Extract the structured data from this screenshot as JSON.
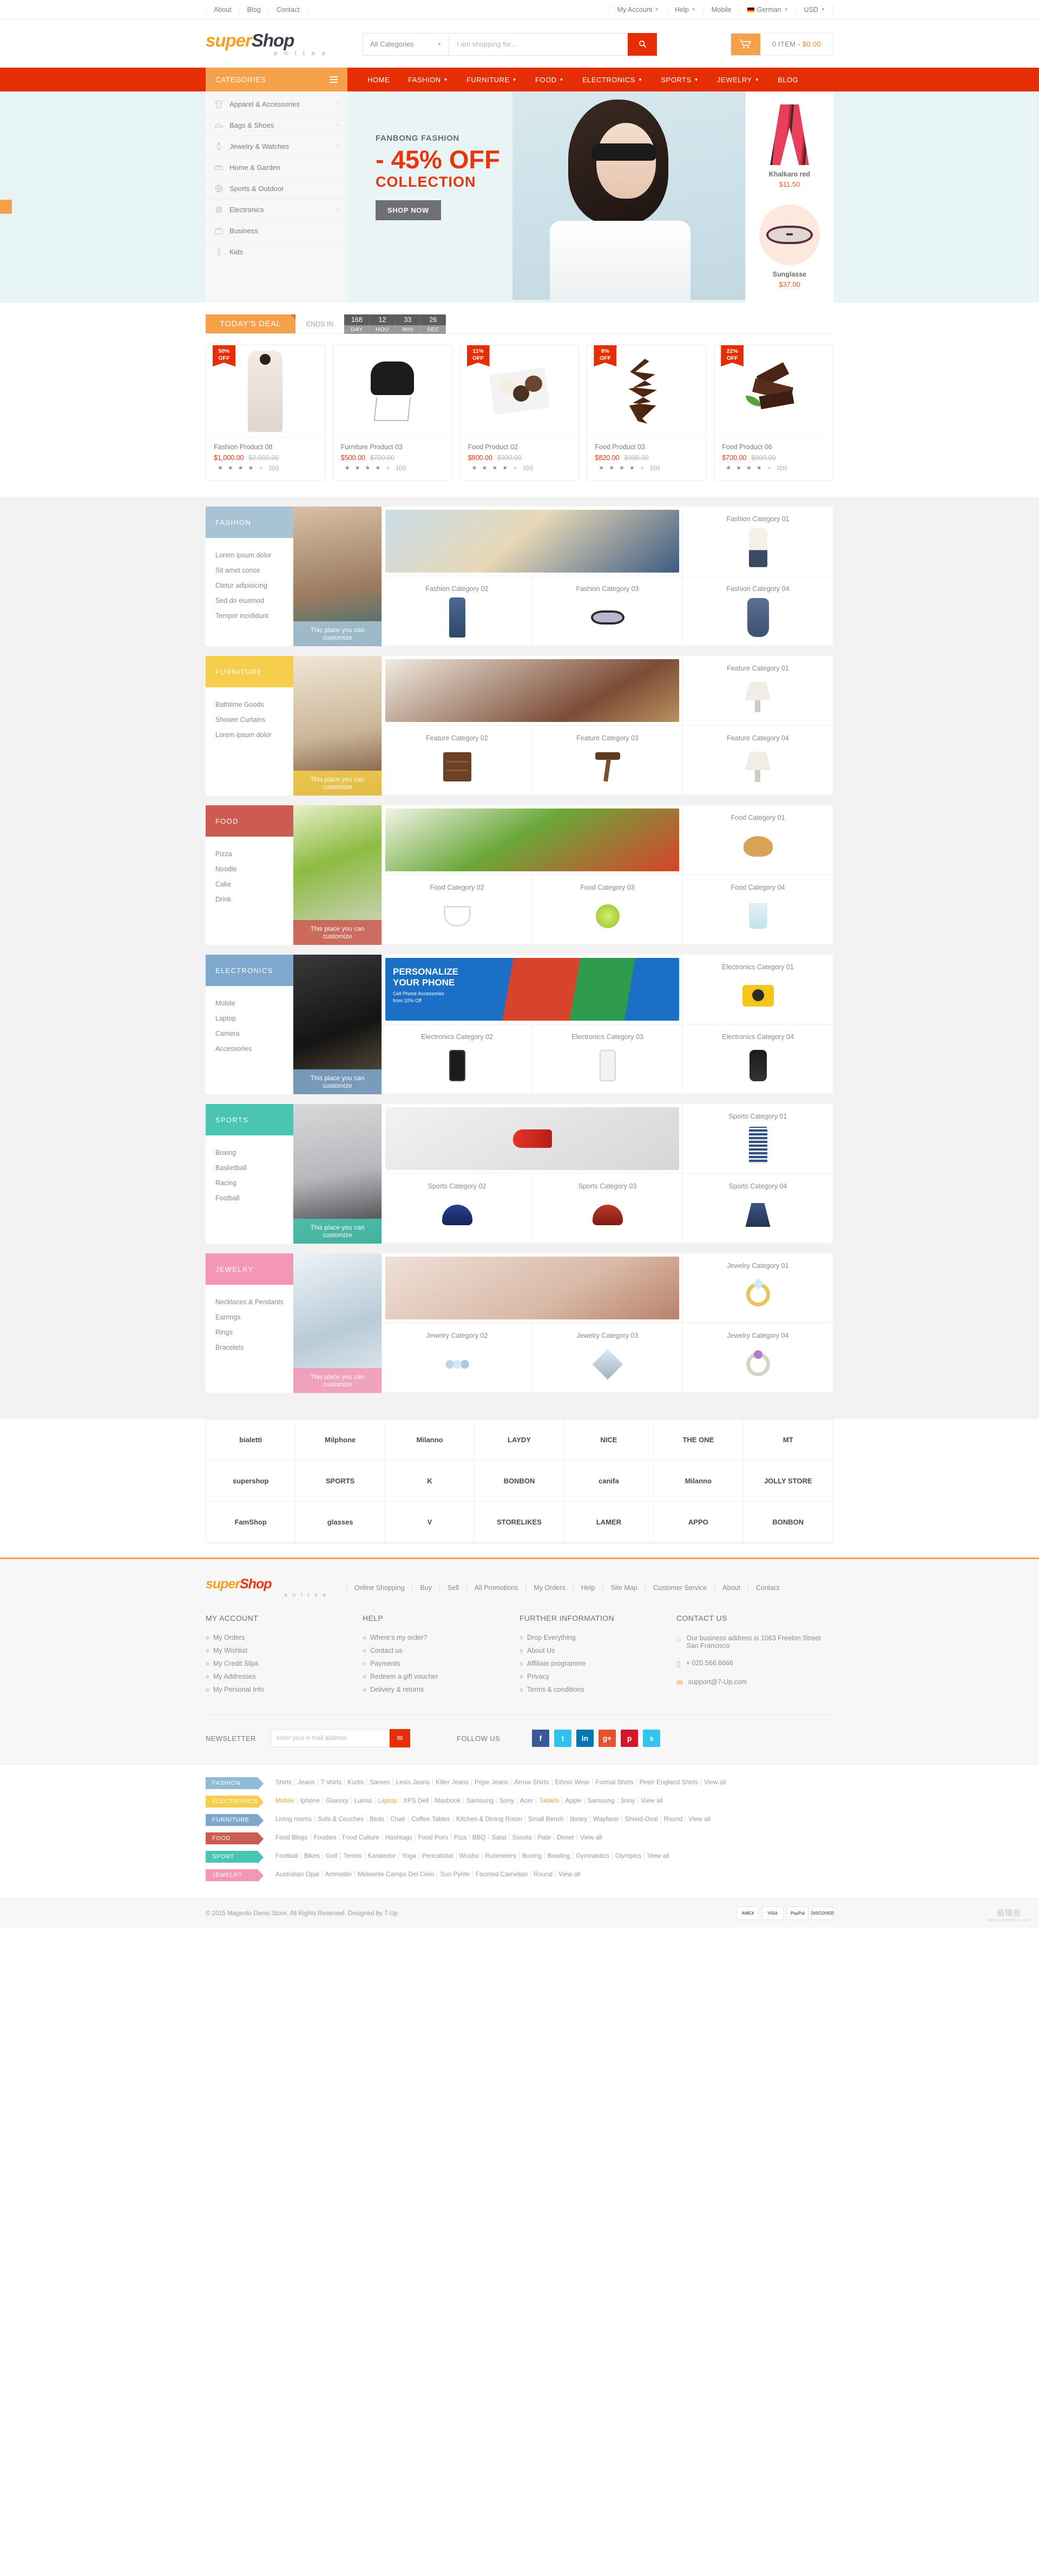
{
  "topbar": {
    "left": [
      {
        "label": "About"
      },
      {
        "label": "Blog"
      },
      {
        "label": "Contact"
      }
    ],
    "right": [
      {
        "label": "My Account",
        "caret": true
      },
      {
        "label": "Help",
        "caret": true
      },
      {
        "label": "Mobile",
        "caret": false
      },
      {
        "label": "German",
        "caret": true,
        "flag": "de-flag-icon"
      },
      {
        "label": "USD",
        "caret": true
      }
    ]
  },
  "header": {
    "logo": {
      "super": "super",
      "shop": "Shop",
      "sub": "o n l i n e"
    },
    "search": {
      "category": "All Categories",
      "placeholder": "I am shopping for...",
      "button_icon": "search-icon"
    },
    "cart": {
      "icon": "cart-icon",
      "label": "0 ITEM -",
      "total": "$0.00"
    }
  },
  "nav": {
    "categories_label": "CATEGORIES",
    "items": [
      {
        "label": "HOME",
        "caret": false
      },
      {
        "label": "FASHION",
        "caret": true
      },
      {
        "label": "FURNITURE",
        "caret": true
      },
      {
        "label": "FOOD",
        "caret": true
      },
      {
        "label": "ELECTRONICS",
        "caret": true
      },
      {
        "label": "SPORTS",
        "caret": true
      },
      {
        "label": "JEWELRY",
        "caret": true
      },
      {
        "label": "BLOG",
        "caret": false
      }
    ]
  },
  "sidebar_categories": [
    {
      "label": "Apparel & Accessories",
      "icon": "tshirt-icon",
      "arrow": true
    },
    {
      "label": "Bags & Shoes",
      "icon": "shoe-icon",
      "arrow": true
    },
    {
      "label": "Jewelry & Watches",
      "icon": "watch-icon",
      "arrow": true
    },
    {
      "label": "Home & Garden",
      "icon": "sofa-icon",
      "arrow": false
    },
    {
      "label": "Sports & Outdoor",
      "icon": "ball-icon",
      "arrow": false
    },
    {
      "label": "Electronics",
      "icon": "chip-icon",
      "arrow": true
    },
    {
      "label": "Business",
      "icon": "briefcase-icon",
      "arrow": false
    },
    {
      "label": "Kids",
      "icon": "bottle-icon",
      "arrow": false
    }
  ],
  "hero": {
    "kicker": "FANBONG FASHION",
    "headline": "- 45% OFF",
    "subline": "COLLECTION",
    "button": "SHOP NOW"
  },
  "side_products": [
    {
      "name": "Khalkaro red",
      "price": "$11.50",
      "art": "scarf-image"
    },
    {
      "name": "Sunglasse",
      "price": "$37.00",
      "art": "sunglasses-image"
    }
  ],
  "deals": {
    "tag": "TODAY'S DEAL",
    "ends_in": "ENDS IN",
    "countdown": [
      {
        "value": "168",
        "unit": "DAY"
      },
      {
        "value": "12",
        "unit": "HOU"
      },
      {
        "value": "33",
        "unit": "MIN"
      },
      {
        "value": "26",
        "unit": "SEC"
      }
    ],
    "products": [
      {
        "badge_pct": "50%",
        "badge_off": "OFF",
        "name": "Fashion Product 08",
        "price": "$1,000.00",
        "old_price": "$2,000.00",
        "stars": 4,
        "reviews": "2(s)",
        "art": "coat-image"
      },
      {
        "badge_pct": "",
        "badge_off": "",
        "name": "Furniture Product 03",
        "price": "$500.00",
        "old_price": "$700.00",
        "stars": 4,
        "reviews": "1(s)",
        "art": "chair-image"
      },
      {
        "badge_pct": "11%",
        "badge_off": "OFF",
        "name": "Food Product 02",
        "price": "$800.00",
        "old_price": "$900.00",
        "stars": 4,
        "reviews": "1(s)",
        "art": "truffle-image"
      },
      {
        "badge_pct": "8%",
        "badge_off": "OFF",
        "name": "Food Product 03",
        "price": "$820.00",
        "old_price": "$900.00",
        "stars": 4,
        "reviews": "2(s)",
        "art": "chocolate-drizzle-image"
      },
      {
        "badge_pct": "22%",
        "badge_off": "OFF",
        "name": "Food Product 06",
        "price": "$700.00",
        "old_price": "$900.00",
        "stars": 4,
        "reviews": "2(s)",
        "art": "chocolate-bar-image"
      }
    ]
  },
  "category_blocks": [
    {
      "title": "FASHION",
      "color": "#a8c4d4",
      "links": [
        "Lorem ipsum dolor",
        "Sit amet conse",
        "Ctetur adipisicing",
        "Sed do eiusmod",
        "Tempor incididunt"
      ],
      "feature_caption": "This place you can customize",
      "cells": [
        {
          "label": "",
          "type": "banner",
          "span": 2,
          "art": "couple-selfie-image"
        },
        {
          "label": "Fashion Category 01",
          "type": "thumb",
          "art": "blouse-image"
        },
        {
          "label": "Fashion Category 02",
          "type": "thumb",
          "art": "jeans-image"
        },
        {
          "label": "Fashion Category 03",
          "type": "thumb",
          "art": "sunglasses-image"
        },
        {
          "label": "Fashion Category 04",
          "type": "thumb",
          "art": "dress-image"
        }
      ]
    },
    {
      "title": "FURNITURE",
      "color": "#f6ce4c",
      "links": [
        "Bathtime Goods",
        "Shower Curtains",
        "Lorem ipsum dolor"
      ],
      "feature_caption": "This place you can customize",
      "cells": [
        {
          "label": "",
          "type": "banner",
          "span": 2,
          "art": "sofa-room-image"
        },
        {
          "label": "Feature Category 01",
          "type": "thumb",
          "art": "white-lamp-image"
        },
        {
          "label": "Feature Category 02",
          "type": "thumb",
          "art": "drawer-image"
        },
        {
          "label": "Feature Category 03",
          "type": "thumb",
          "art": "stool-image"
        },
        {
          "label": "Feature Category 04",
          "type": "thumb",
          "art": "lamp-image"
        }
      ]
    },
    {
      "title": "FOOD",
      "color": "#cc5b51",
      "links": [
        "Pizza",
        "Noodle",
        "Cake",
        "Drink"
      ],
      "feature_caption": "This place you can customize",
      "cells": [
        {
          "label": "",
          "type": "banner",
          "span": 2,
          "art": "salad-image"
        },
        {
          "label": "Food Category 01",
          "type": "thumb",
          "art": "coffee-croissant-image"
        },
        {
          "label": "Food Category 02",
          "type": "thumb",
          "art": "coffee-cup-image"
        },
        {
          "label": "Food Category 03",
          "type": "thumb",
          "art": "lime-image"
        },
        {
          "label": "Food Category 04",
          "type": "thumb",
          "art": "drink-glass-image"
        }
      ]
    },
    {
      "title": "ELECTRONICS",
      "color": "#7fa8ce",
      "links": [
        "Mobile",
        "Laptop",
        "Camera",
        "Accessories"
      ],
      "feature_caption": "This place you can customize",
      "cells": [
        {
          "label": "",
          "type": "banner",
          "span": 2,
          "art": "personalize-phone-banner",
          "banner_text_1": "PERSONALIZE",
          "banner_text_2": "YOUR PHONE",
          "banner_text_3": "Cell Phone Accessories",
          "banner_text_4": "from 10% Off"
        },
        {
          "label": "Electronics Category 01",
          "type": "thumb",
          "art": "yellow-camera-image"
        },
        {
          "label": "Electronics Category 02",
          "type": "thumb",
          "art": "black-phone-image"
        },
        {
          "label": "Electronics Category 03",
          "type": "thumb",
          "art": "white-phone-image"
        },
        {
          "label": "Electronics Category 04",
          "type": "thumb",
          "art": "grey-phone-image"
        }
      ]
    },
    {
      "title": "SPORTS",
      "color": "#49c5b1",
      "links": [
        "Boxing",
        "Basketball",
        "Racing",
        "Football"
      ],
      "feature_caption": "This place you can customize",
      "cells": [
        {
          "label": "",
          "type": "banner",
          "span": 2,
          "art": "red-soccer-shoe-image"
        },
        {
          "label": "Sports Category 01",
          "type": "thumb",
          "art": "tennis-racket-image"
        },
        {
          "label": "Sports Category 02",
          "type": "thumb",
          "art": "blue-helmet-image"
        },
        {
          "label": "Sports Category 03",
          "type": "thumb",
          "art": "red-helmet-image"
        },
        {
          "label": "Sports Category 04",
          "type": "thumb",
          "art": "blue-skirt-image"
        }
      ]
    },
    {
      "title": "JEWELRY",
      "color": "#f497b5",
      "links": [
        "Necklaces & Pendants",
        "Earrings",
        "Rings",
        "Bracelets"
      ],
      "feature_caption": "This place you can customize",
      "cells": [
        {
          "label": "",
          "type": "banner",
          "span": 2,
          "art": "hands-ring-image"
        },
        {
          "label": "Jewelry Category 01",
          "type": "thumb",
          "art": "gold-ring-image"
        },
        {
          "label": "Jewelry Category 02",
          "type": "thumb",
          "art": "bead-necklace-image"
        },
        {
          "label": "Jewelry Category 03",
          "type": "thumb",
          "art": "gem-image"
        },
        {
          "label": "Jewelry Category 04",
          "type": "thumb",
          "art": "purple-ring-image"
        }
      ]
    }
  ],
  "brands": [
    "bialetti",
    "Milphone",
    "Milanno",
    "LAYDY",
    "NICE",
    "THE ONE",
    "MT",
    "supershop",
    "SPORTS",
    "K",
    "BONBON",
    "canifa",
    "Milanno",
    "JOLLY STORE",
    "FamShop",
    "glasses",
    "V",
    "STORELIKES",
    "LAMER",
    "APPO",
    "BONBON"
  ],
  "footer": {
    "logo": {
      "super": "super",
      "shop": "Shop",
      "sub": "o n l i n e"
    },
    "top_links": [
      "Online Shopping",
      "Buy",
      "Sell",
      "All Promotions",
      "My Orders",
      "Help",
      "Site Map",
      "Customer Service",
      "About",
      "Contact"
    ],
    "columns": [
      {
        "title": "MY ACCOUNT",
        "items": [
          "My Orders",
          "My Wishlist",
          "My Credit Slips",
          "My Addresses",
          "My Personal Info"
        ]
      },
      {
        "title": "HELP",
        "items": [
          "Where's my order?",
          "Contact us",
          "Payments",
          "Redeem a gift voucher",
          "Delivery & returns"
        ]
      },
      {
        "title": "FURTHER INFORMATION",
        "items": [
          "Drop Everything",
          "About Us",
          "Affiliate programme",
          "Privacy",
          "Terms & conditions"
        ]
      }
    ],
    "contact": {
      "title": "CONTACT US",
      "address": "Our business address is 1063 Freelon Street San Francisco",
      "phone": "+ 020.566.6666",
      "email": "support@7-Up.com",
      "address_icon": "home-icon",
      "phone_icon": "phone-icon",
      "email_icon": "mail-icon"
    },
    "newsletter": {
      "label": "NEWSLETTER",
      "placeholder": "enter your e-mail address",
      "button_icon": "mail-icon"
    },
    "follow": {
      "label": "FOLLOW US",
      "socials": [
        {
          "name": "facebook-icon",
          "glyph": "f",
          "color": "#3b5998"
        },
        {
          "name": "twitter-icon",
          "glyph": "t",
          "color": "#2fc2ef"
        },
        {
          "name": "linkedin-icon",
          "glyph": "in",
          "color": "#0077b5"
        },
        {
          "name": "google-plus-icon",
          "glyph": "g+",
          "color": "#e8502f"
        },
        {
          "name": "pinterest-icon",
          "glyph": "p",
          "color": "#d6142c"
        },
        {
          "name": "skype-icon",
          "glyph": "s",
          "color": "#31c4ef"
        }
      ]
    }
  },
  "tag_rows": [
    {
      "label": "FASHION",
      "color": "#8fbcd4",
      "tags": [
        "Shirts",
        "Jeans",
        "T shirts",
        "Kurtis",
        "Sarees",
        "Levis Jeans",
        "Killer Jeans",
        "Pepe Jeans",
        "Arrow Shirts",
        "Ethnic Wear",
        "Formal Shirts",
        "Peter England Shirts",
        "View all"
      ],
      "highlight": []
    },
    {
      "label": "ELECTRONICS",
      "color": "#f6ce4c",
      "tags": [
        "Mobile",
        "Iphone",
        "Glassxy",
        "Lumia",
        "Laptop",
        "XPS Dell",
        "Maxbook",
        "Samsung",
        "Sony",
        "Acer",
        "Tablets",
        "Apple",
        "Samsung",
        "Sony",
        "View all"
      ],
      "highlight": [
        "Mobile",
        "Laptop",
        "Tablets"
      ]
    },
    {
      "label": "FURNITURE",
      "color": "#7fa8ce",
      "tags": [
        "Living rooms",
        "Sofa & Couches",
        "Beds",
        "Chair",
        "Coffee Tables",
        "Kitchen & Dining Room",
        "Small Bench",
        "library",
        "Wayfarer",
        "Shield-Oval",
        "Round",
        "View all"
      ],
      "highlight": []
    },
    {
      "label": "FOOD",
      "color": "#cc5b51",
      "tags": [
        "Food Blogs",
        "Foodies",
        "Food Culture",
        "Hashtags",
        "Food Porn",
        "Piza",
        "BBQ",
        "Salat",
        "Socola",
        "Pate",
        "Doner",
        "View all"
      ],
      "highlight": []
    },
    {
      "label": "SPORT",
      "color": "#49c5b1",
      "tags": [
        "Football",
        "Bikes",
        "Golf",
        "Tennis",
        "Karatedor",
        "Yoga",
        "Pencatsilat",
        "Wushu",
        "Runmeters",
        "Boxing",
        "Bowling",
        "Gymnastics",
        "Olympics",
        "View all"
      ],
      "highlight": []
    },
    {
      "label": "JEWELRY",
      "color": "#f497b5",
      "tags": [
        "Australian Opal",
        "Ammolite",
        "Meteorite Campo Del Cielo",
        "Sun Pyrite",
        "Faceted Carnelian",
        "Round",
        "View all"
      ],
      "highlight": []
    }
  ],
  "copyright": {
    "text": "© 2015 Magento Demo Store. All Rights Reserved. Designed by 7-Up",
    "payments": [
      "AMEX",
      "VISA",
      "PayPal",
      "DISCOVER"
    ],
    "stamp": "最模板",
    "stamp_sub": "www.cssmoban.com"
  }
}
